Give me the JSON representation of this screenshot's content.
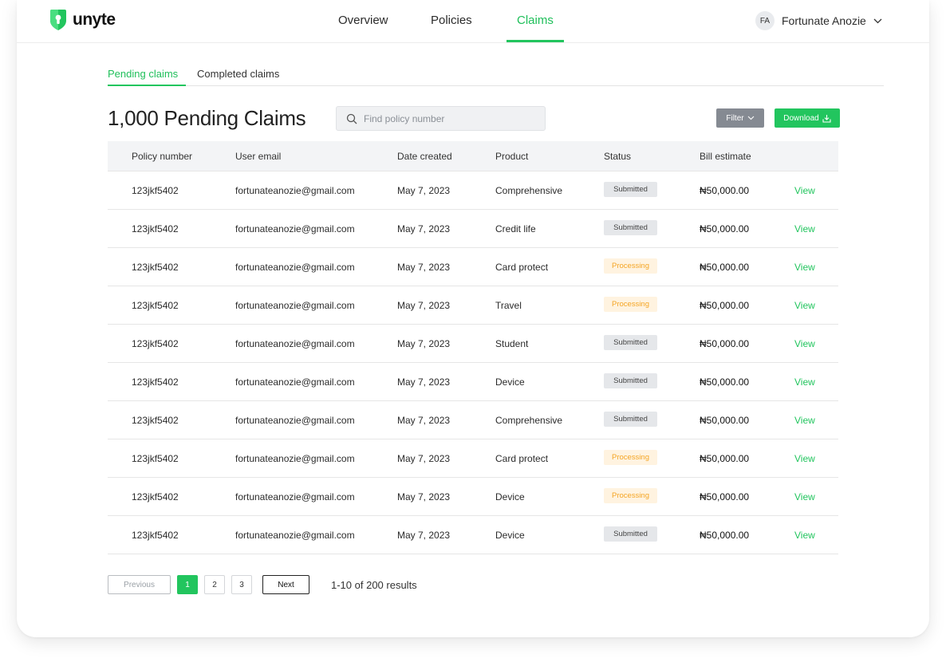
{
  "app": {
    "brand": "unyte",
    "accent_color": "#22c55e"
  },
  "nav": {
    "items": [
      "Overview",
      "Policies",
      "Claims"
    ],
    "active": "Claims"
  },
  "user": {
    "initials": "FA",
    "name": "Fortunate Anozie"
  },
  "subtabs": {
    "items": [
      "Pending claims",
      "Completed claims"
    ],
    "active": "Pending claims"
  },
  "page": {
    "title": "1,000 Pending Claims"
  },
  "search": {
    "placeholder": "Find policy number",
    "value": ""
  },
  "toolbar": {
    "filter_label": "Filter",
    "download_label": "Download"
  },
  "table": {
    "columns": [
      "Policy number",
      "User email",
      "Date created",
      "Product",
      "Status",
      "Bill estimate"
    ],
    "action_label": "View",
    "rows": [
      {
        "policy": "123jkf5402",
        "email": "fortunateanozie@gmail.com",
        "date": "May 7, 2023",
        "product": "Comprehensive",
        "status": "Submitted",
        "bill": "₦50,000.00"
      },
      {
        "policy": "123jkf5402",
        "email": "fortunateanozie@gmail.com",
        "date": "May 7, 2023",
        "product": "Credit life",
        "status": "Submitted",
        "bill": "₦50,000.00"
      },
      {
        "policy": "123jkf5402",
        "email": "fortunateanozie@gmail.com",
        "date": "May 7, 2023",
        "product": "Card protect",
        "status": "Processing",
        "bill": "₦50,000.00"
      },
      {
        "policy": "123jkf5402",
        "email": "fortunateanozie@gmail.com",
        "date": "May 7, 2023",
        "product": "Travel",
        "status": "Processing",
        "bill": "₦50,000.00"
      },
      {
        "policy": "123jkf5402",
        "email": "fortunateanozie@gmail.com",
        "date": "May 7, 2023",
        "product": "Student",
        "status": "Submitted",
        "bill": "₦50,000.00"
      },
      {
        "policy": "123jkf5402",
        "email": "fortunateanozie@gmail.com",
        "date": "May 7, 2023",
        "product": "Device",
        "status": "Submitted",
        "bill": "₦50,000.00"
      },
      {
        "policy": "123jkf5402",
        "email": "fortunateanozie@gmail.com",
        "date": "May 7, 2023",
        "product": "Comprehensive",
        "status": "Submitted",
        "bill": "₦50,000.00"
      },
      {
        "policy": "123jkf5402",
        "email": "fortunateanozie@gmail.com",
        "date": "May 7, 2023",
        "product": "Card protect",
        "status": "Processing",
        "bill": "₦50,000.00"
      },
      {
        "policy": "123jkf5402",
        "email": "fortunateanozie@gmail.com",
        "date": "May 7, 2023",
        "product": "Device",
        "status": "Processing",
        "bill": "₦50,000.00"
      },
      {
        "policy": "123jkf5402",
        "email": "fortunateanozie@gmail.com",
        "date": "May 7, 2023",
        "product": "Device",
        "status": "Submitted",
        "bill": "₦50,000.00"
      }
    ]
  },
  "pagination": {
    "previous_label": "Previous",
    "next_label": "Next",
    "pages": [
      "1",
      "2",
      "3"
    ],
    "current_page": "1",
    "summary": "1-10 of 200 results"
  },
  "icons": {
    "logo": "shield-keyhole-icon",
    "search": "search-icon",
    "chevron": "chevron-down-icon",
    "download": "download-icon"
  }
}
